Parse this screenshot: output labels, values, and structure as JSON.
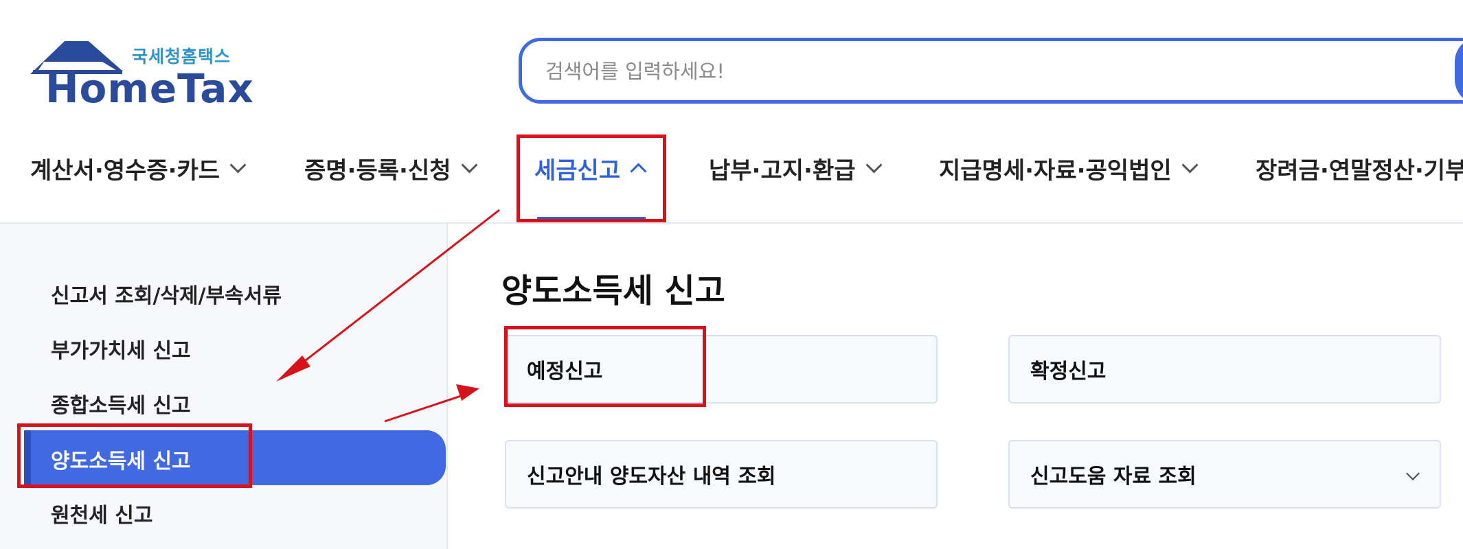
{
  "logo": {
    "subtitle": "국세청홈택스",
    "title": "HomeTax"
  },
  "search": {
    "placeholder": "검색어를 입력하세요!"
  },
  "nav": {
    "items": [
      {
        "label": "계산서·영수증·카드"
      },
      {
        "label": "증명·등록·신청"
      },
      {
        "label": "세금신고"
      },
      {
        "label": "납부·고지·환급"
      },
      {
        "label": "지급명세·자료·공익법인"
      },
      {
        "label": "장려금·연말정산·기부"
      }
    ]
  },
  "sidebar": {
    "items": [
      {
        "label": "신고서 조회/삭제/부속서류"
      },
      {
        "label": "부가가치세 신고"
      },
      {
        "label": "종합소득세 신고"
      },
      {
        "label": "양도소득세 신고"
      },
      {
        "label": "원천세 신고"
      }
    ]
  },
  "main": {
    "title": "양도소득세 신고",
    "cards": [
      {
        "label": "예정신고"
      },
      {
        "label": "확정신고"
      },
      {
        "label": "신고안내 양도자산 내역 조회"
      },
      {
        "label": "신고도움 자료 조회"
      }
    ]
  },
  "colors": {
    "accent": "#4169e1",
    "brand": "#2a4b9b",
    "annotation": "#d6121b"
  }
}
